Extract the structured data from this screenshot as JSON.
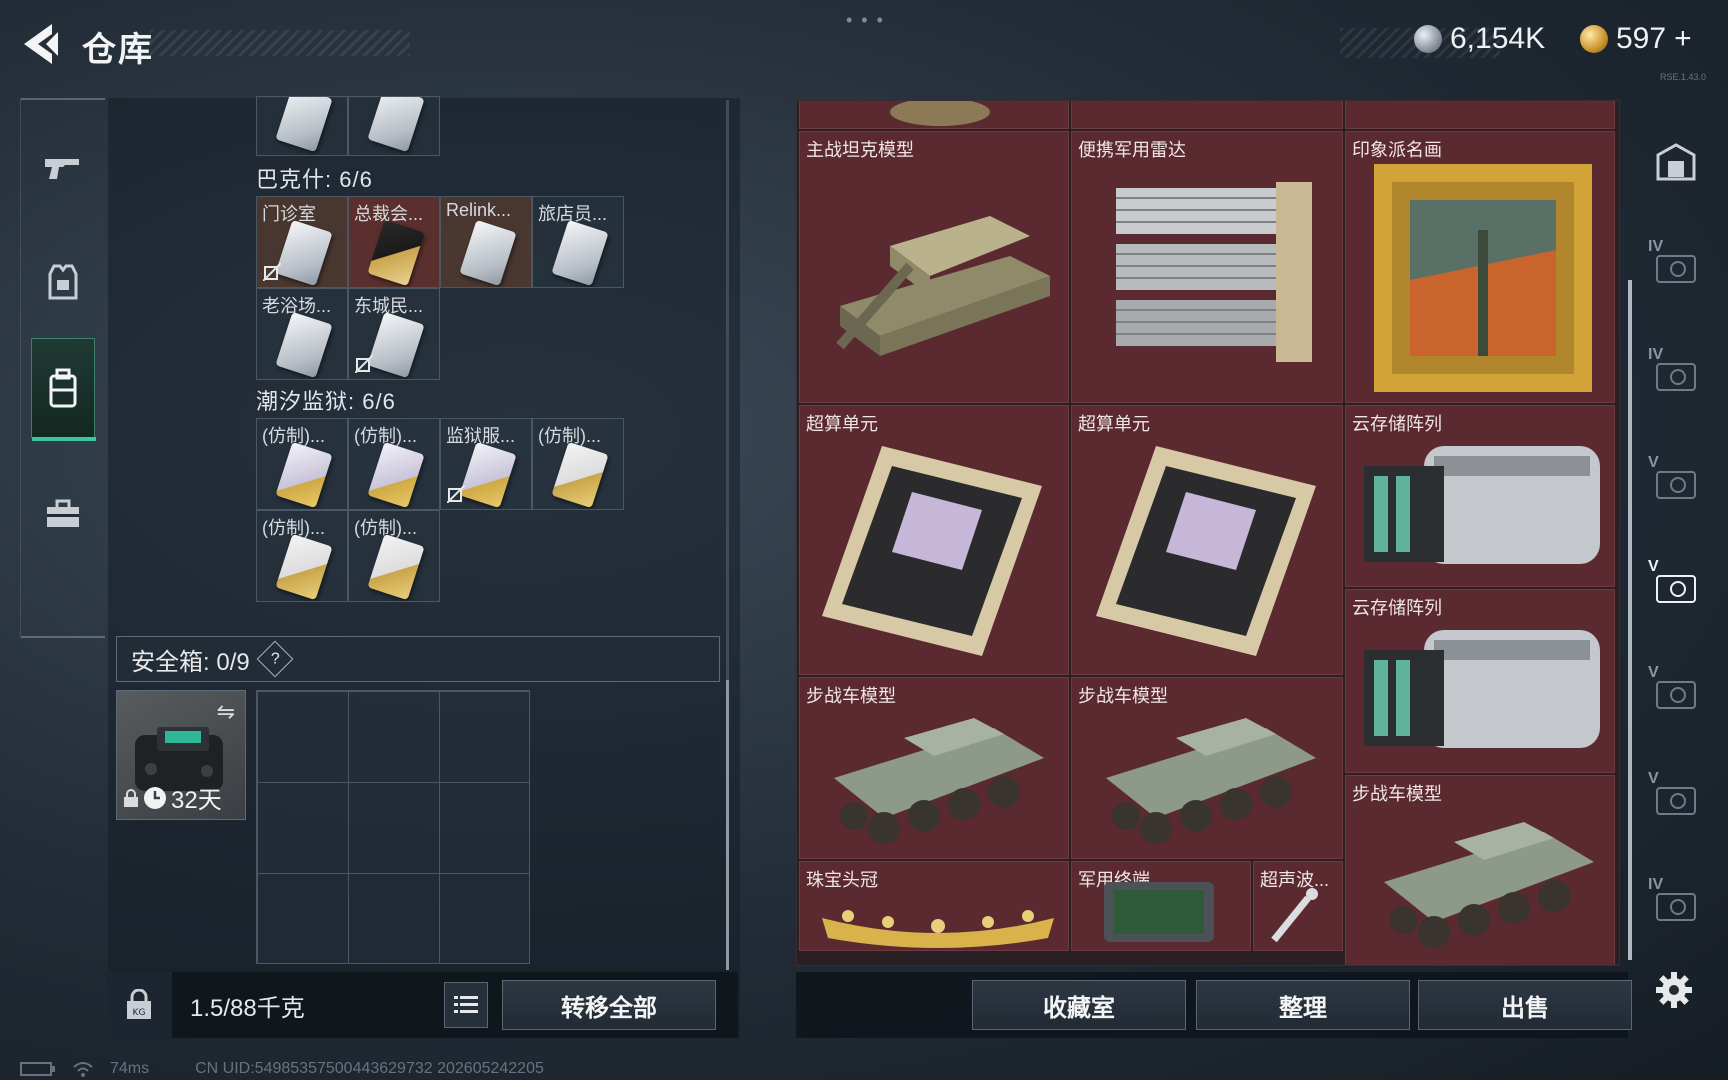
{
  "header": {
    "title": "仓库",
    "currency_silver": "6,154K",
    "currency_gold": "597",
    "currency_gold_add": "+",
    "tiny_code": "RSE.1.43.0"
  },
  "left_nav": {
    "items": [
      "weapon",
      "gear",
      "backpack",
      "case"
    ],
    "active": "backpack"
  },
  "bag": {
    "bakeshi": {
      "title": "巴克什: 6/6",
      "items": [
        "门诊室",
        "总裁会...",
        "Relink...",
        "旅店员...",
        "老浴场...",
        "东城民..."
      ]
    },
    "prison": {
      "title": "潮汐监狱: 6/6",
      "items": [
        "(仿制)...",
        "(仿制)...",
        "监狱服...",
        "(仿制)...",
        "(仿制)...",
        "(仿制)..."
      ]
    },
    "safebox": {
      "label": "安全箱: ",
      "count": "0/9",
      "help": "?",
      "timer": "32天"
    },
    "footer": {
      "weight": "1.5/88千克",
      "transfer_all": "转移全部"
    }
  },
  "stash": {
    "items": {
      "tank": "主战坦克模型",
      "radar": "便携军用雷达",
      "painting": "印象派名画",
      "compute1": "超算单元",
      "compute2": "超算单元",
      "cloud1": "云存储阵列",
      "cloud2": "云存储阵列",
      "ifv1": "步战车模型",
      "ifv2": "步战车模型",
      "ifv3": "步战车模型",
      "crown": "珠宝头冠",
      "terminal": "军用终端",
      "ultrasonic": "超声波..."
    },
    "buttons": {
      "collection": "收藏室",
      "sort": "整理",
      "sell": "出售"
    }
  },
  "right_tabs": {
    "tiers": [
      "",
      "IV",
      "IV",
      "V",
      "V",
      "V",
      "V",
      "IV"
    ],
    "active_index": 4
  },
  "status": {
    "ping": "74ms",
    "uid": "CN UID:54985357500443629732 202605242205"
  },
  "colors": {
    "accent_green": "#3ec79b",
    "stash_bg": "#5a2a30"
  }
}
